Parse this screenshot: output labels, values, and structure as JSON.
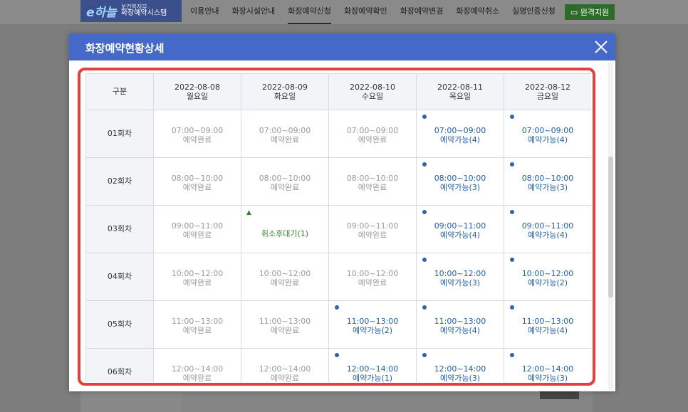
{
  "site": {
    "logo_mark": "e하늘",
    "logo_line1": "보건복지부",
    "logo_line2": "화장예약시스템",
    "nav": [
      "이용안내",
      "화장시설안내",
      "화장예약신청",
      "화장예약확인",
      "화장예약변경",
      "화장예약취소",
      "실명인증신청"
    ],
    "active_nav": "화장예약신청",
    "remote_support": "원격지원"
  },
  "modal": {
    "title": "화장예약현황상세",
    "table": {
      "corner_header": "구분",
      "columns": [
        {
          "date": "2022-08-08",
          "day": "월요일"
        },
        {
          "date": "2022-08-09",
          "day": "화요일"
        },
        {
          "date": "2022-08-10",
          "day": "수요일"
        },
        {
          "date": "2022-08-11",
          "day": "목요일"
        },
        {
          "date": "2022-08-12",
          "day": "금요일"
        }
      ],
      "rows": [
        {
          "label": "01회차",
          "cells": [
            {
              "state": "done",
              "time": "07:00~09:00",
              "status": "예약완료"
            },
            {
              "state": "done",
              "time": "07:00~09:00",
              "status": "예약완료"
            },
            {
              "state": "done",
              "time": "07:00~09:00",
              "status": "예약완료"
            },
            {
              "state": "avail",
              "time": "07:00~09:00",
              "status": "예약가능(4)"
            },
            {
              "state": "avail",
              "time": "07:00~09:00",
              "status": "예약가능(4)"
            }
          ]
        },
        {
          "label": "02회차",
          "cells": [
            {
              "state": "done",
              "time": "08:00~10:00",
              "status": "예약완료"
            },
            {
              "state": "done",
              "time": "08:00~10:00",
              "status": "예약완료"
            },
            {
              "state": "done",
              "time": "08:00~10:00",
              "status": "예약완료"
            },
            {
              "state": "avail",
              "time": "08:00~10:00",
              "status": "예약가능(3)"
            },
            {
              "state": "avail",
              "time": "08:00~10:00",
              "status": "예약가능(3)"
            }
          ]
        },
        {
          "label": "03회차",
          "cells": [
            {
              "state": "done",
              "time": "09:00~11:00",
              "status": "예약완료"
            },
            {
              "state": "wait",
              "time": "",
              "status": "취소후대기(1)"
            },
            {
              "state": "done",
              "time": "09:00~11:00",
              "status": "예약완료"
            },
            {
              "state": "avail",
              "time": "09:00~11:00",
              "status": "예약가능(4)"
            },
            {
              "state": "avail",
              "time": "09:00~11:00",
              "status": "예약가능(4)"
            }
          ]
        },
        {
          "label": "04회차",
          "cells": [
            {
              "state": "done",
              "time": "10:00~12:00",
              "status": "예약완료"
            },
            {
              "state": "done",
              "time": "10:00~12:00",
              "status": "예약완료"
            },
            {
              "state": "done",
              "time": "10:00~12:00",
              "status": "예약완료"
            },
            {
              "state": "avail",
              "time": "10:00~12:00",
              "status": "예약가능(3)"
            },
            {
              "state": "avail",
              "time": "10:00~12:00",
              "status": "예약가능(2)"
            }
          ]
        },
        {
          "label": "05회차",
          "cells": [
            {
              "state": "done",
              "time": "11:00~13:00",
              "status": "예약완료"
            },
            {
              "state": "done",
              "time": "11:00~13:00",
              "status": "예약완료"
            },
            {
              "state": "avail",
              "time": "11:00~13:00",
              "status": "예약가능(2)"
            },
            {
              "state": "avail",
              "time": "11:00~13:00",
              "status": "예약가능(4)"
            },
            {
              "state": "avail",
              "time": "11:00~13:00",
              "status": "예약가능(4)"
            }
          ]
        },
        {
          "label": "06회차",
          "cells": [
            {
              "state": "done",
              "time": "12:00~14:00",
              "status": "예약완료"
            },
            {
              "state": "done",
              "time": "12:00~14:00",
              "status": "예약완료"
            },
            {
              "state": "avail",
              "time": "12:00~14:00",
              "status": "예약가능(1)"
            },
            {
              "state": "avail",
              "time": "12:00~14:00",
              "status": "예약가능(3)"
            },
            {
              "state": "avail",
              "time": "12:00~14:00",
              "status": "예약가능(3)"
            }
          ]
        }
      ]
    }
  },
  "colors": {
    "header_blue": "#4469c9",
    "available_blue": "#1f5fb3",
    "waitlist_green": "#2d8a2a",
    "done_gray": "#9a9a9a",
    "highlight_red": "#e2403a"
  },
  "icons": {
    "close": "close-icon",
    "available_marker": "dot-icon",
    "waitlist_marker": "triangle-icon",
    "remote": "monitor-icon"
  }
}
